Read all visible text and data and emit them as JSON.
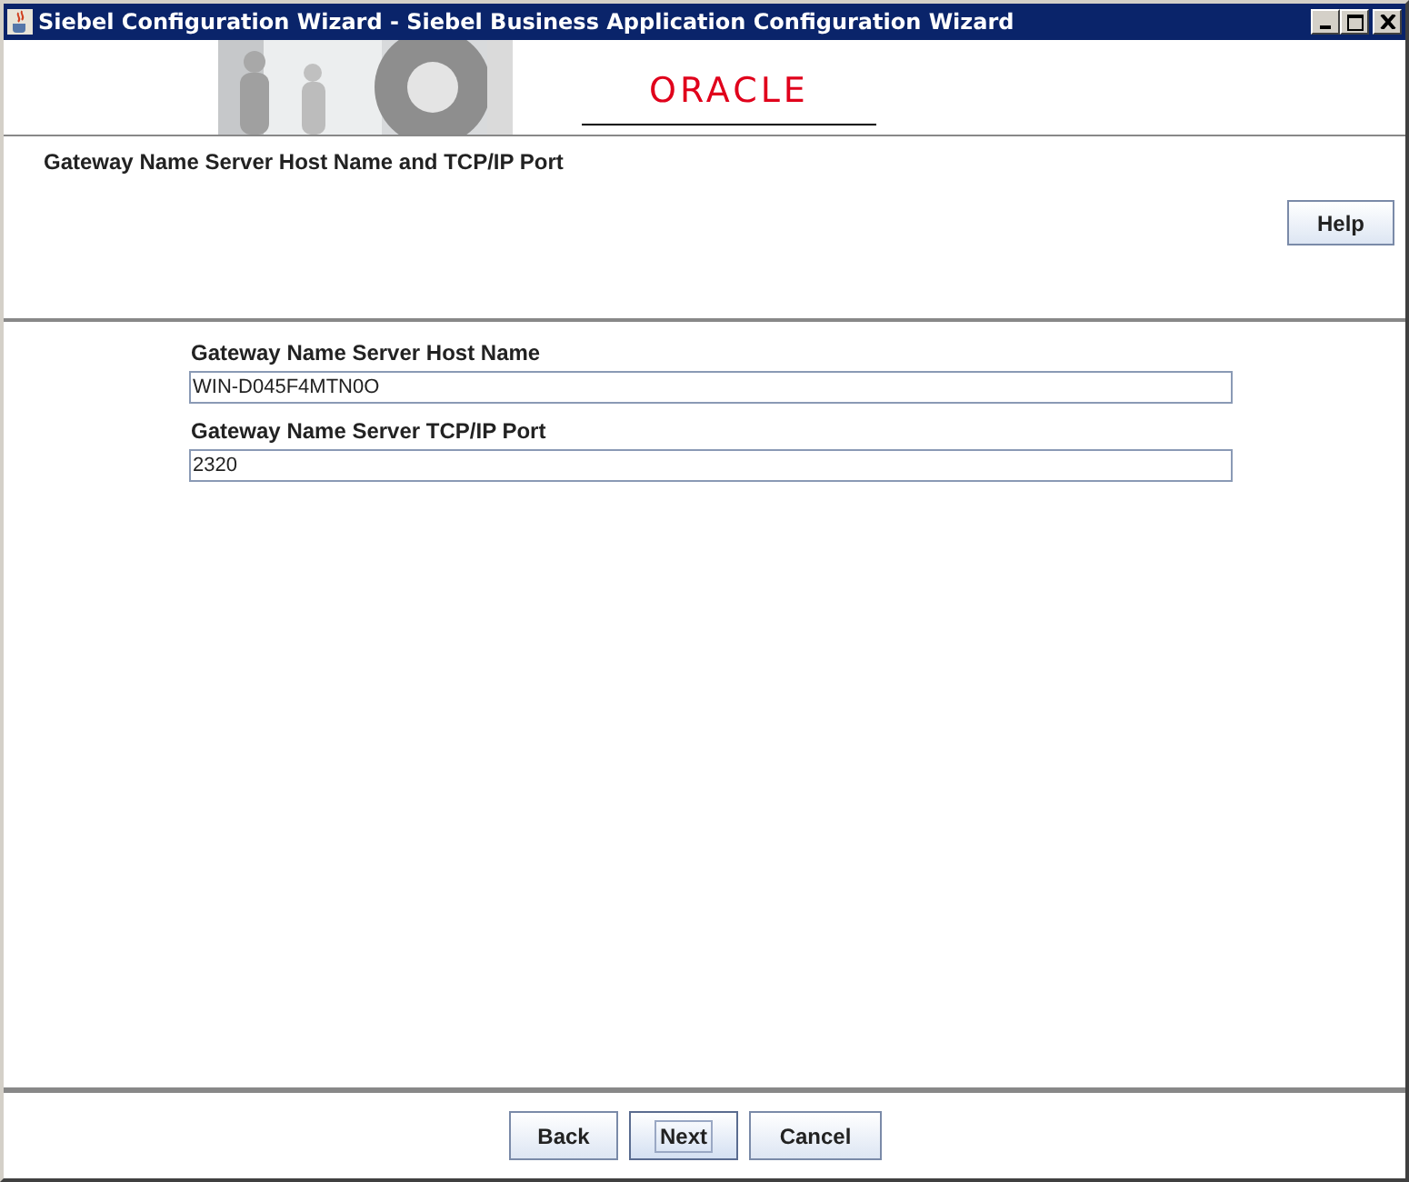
{
  "window": {
    "title": "Siebel Configuration Wizard - Siebel Business Application Configuration Wizard"
  },
  "banner": {
    "logo": "ORACLE"
  },
  "header": {
    "title": "Gateway Name Server Host Name and TCP/IP Port",
    "help_button": "Help"
  },
  "fields": [
    {
      "label": "Gateway Name Server Host Name",
      "value": "WIN-D045F4MTN0O"
    },
    {
      "label": "Gateway Name Server TCP/IP Port",
      "value": "2320"
    }
  ],
  "buttons": [
    {
      "label": "Back",
      "focused": false
    },
    {
      "label": "Next",
      "focused": true
    },
    {
      "label": "Cancel",
      "focused": false
    }
  ]
}
